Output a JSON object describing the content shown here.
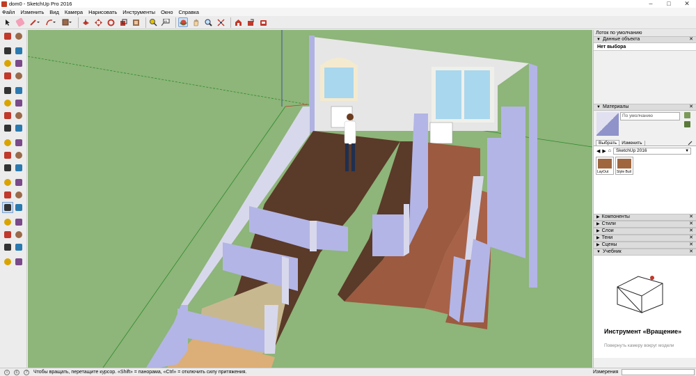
{
  "window": {
    "title": "dom0 - SketchUp Pro 2016",
    "min": "–",
    "max": "□",
    "close": "✕"
  },
  "menu": [
    "Файл",
    "Изменить",
    "Вид",
    "Камера",
    "Нарисовать",
    "Инструменты",
    "Окно",
    "Справка"
  ],
  "tray": {
    "header": "Лоток по умолчанию",
    "entity_info": {
      "title": "Данные объекта",
      "value": "Нет выбора"
    },
    "materials": {
      "title": "Материалы",
      "default_name": "По умолчанию",
      "tabs": [
        "Выбрать",
        "Изменить"
      ],
      "library": "SketchUp 2016",
      "items": [
        "LayOut",
        "Style Buil"
      ]
    },
    "collapsed_panels": [
      "Компоненты",
      "Стили",
      "Слои",
      "Тени",
      "Сцены"
    ],
    "instructor": {
      "title": "Учебник",
      "tool_title": "Инструмент «Вращение»",
      "tool_desc": "Повернуть камеру вокруг модели"
    }
  },
  "status": {
    "message": "Чтобы вращать, перетащите курсор. «Shift» = панорама, «Ctrl» = отключить силу притяжения.",
    "measurements_label": "Измерения",
    "measurements_value": ""
  },
  "colors": {
    "sky_ground": "#8eb57a",
    "wall_face": "#a7a9e0",
    "wall_top": "#d8d8ec",
    "floor_dark": "#5a3a28",
    "floor_brick": "#9c5a40",
    "floor_tile": "#c8b890",
    "floor_wood": "#dcae78"
  },
  "icons": {
    "toolbar": [
      "select-icon",
      "eraser-icon",
      "pencil-icon",
      "arc-icon",
      "rectangle-icon",
      "push-pull-icon",
      "move-icon",
      "rotate-icon",
      "scale-icon",
      "offset-icon",
      "tape-icon",
      "text-icon",
      "orbit-icon",
      "pan-icon",
      "zoom-icon",
      "zoom-extents-icon",
      "warehouse-icon",
      "share-icon",
      "extension-icon"
    ],
    "left": [
      "select-icon",
      "component-icon",
      "paint-bucket-icon",
      "eraser-icon",
      "line-icon",
      "freehand-icon",
      "rectangle-icon",
      "rotated-rect-icon",
      "circle-icon",
      "polygon-icon",
      "arc-icon",
      "pie-icon",
      "arc2-icon",
      "arc3-icon",
      "move-icon",
      "push-pull-icon",
      "rotate-icon",
      "follow-me-icon",
      "scale-icon",
      "offset-icon",
      "tape-icon",
      "dimension-icon",
      "protractor-icon",
      "text-icon",
      "axes-icon",
      "3d-text-icon",
      "orbit-icon",
      "pan-icon",
      "zoom-icon",
      "zoom-window-icon",
      "zoom-extents-icon",
      "previous-icon",
      "position-camera-icon",
      "look-around-icon",
      "walk-icon",
      "section-icon"
    ]
  }
}
